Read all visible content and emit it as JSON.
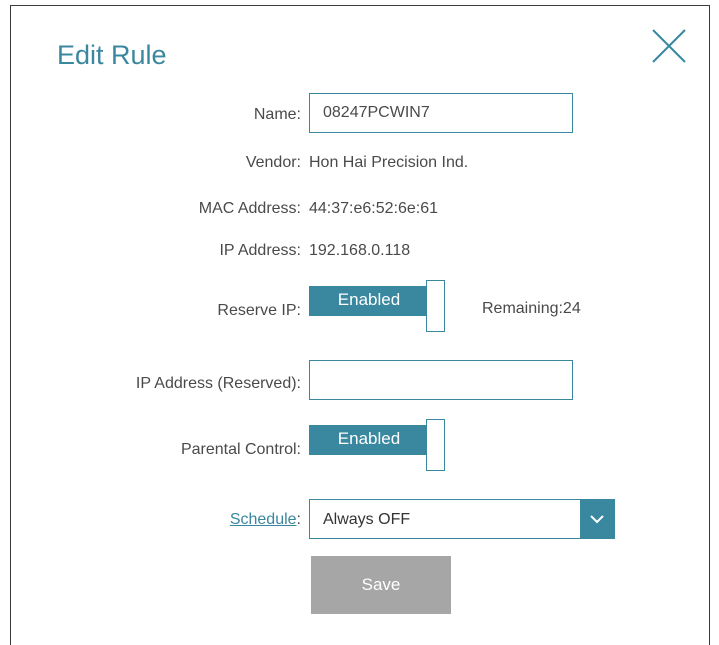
{
  "dialog": {
    "title": "Edit Rule",
    "close_icon": "close-icon"
  },
  "form": {
    "name_label": "Name:",
    "name_value": "08247PCWIN7",
    "vendor_label": "Vendor:",
    "vendor_value": "Hon Hai Precision Ind.",
    "mac_label": "MAC Address:",
    "mac_value": "44:37:e6:52:6e:61",
    "ip_label": "IP Address:",
    "ip_value": "192.168.0.118",
    "reserve_ip_label": "Reserve IP:",
    "reserve_ip_state": "Enabled",
    "remaining_text": "Remaining:24",
    "ip_reserved_label": "IP Address (Reserved):",
    "ip_reserved_value": "",
    "parental_label": "Parental Control:",
    "parental_state": "Enabled",
    "schedule_label": "Schedule",
    "schedule_colon": ":",
    "schedule_value": "Always OFF",
    "schedule_arrow_icon": "chevron-down-icon",
    "save_label": "Save"
  },
  "colors": {
    "accent": "#3a87a0",
    "button_disabled": "#a6a6a6",
    "text": "#4a4a4a"
  }
}
